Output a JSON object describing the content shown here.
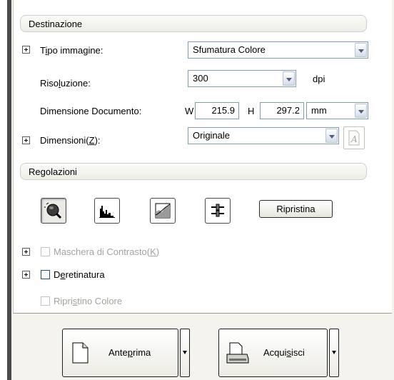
{
  "destinazione": {
    "header": "Destinazione",
    "tipo_label_pre": "T",
    "tipo_label_ul": "i",
    "tipo_label_post": "po immagine:",
    "tipo_value": "Sfumatura Colore",
    "risoluzione_label_pre": "Riso",
    "risoluzione_label_ul": "l",
    "risoluzione_label_post": "uzione:",
    "risoluzione_value": "300",
    "risoluzione_unit": "dpi",
    "dimdoc_label": "Dimensione Documento:",
    "w_label": "W",
    "w_value": "215.9",
    "h_label": "H",
    "h_value": "297.2",
    "unit_value": "mm",
    "dimensioni_label_pre": "Dimensioni(",
    "dimensioni_label_ul": "Z",
    "dimensioni_label_post": "):",
    "dimensioni_value": "Originale"
  },
  "regolazioni": {
    "header": "Regolazioni",
    "ripristina_label": "Ripristina",
    "maschera_pre": "Maschera di Contrasto(",
    "maschera_ul": "K",
    "maschera_post": ")",
    "deretinatura_pre": "D",
    "deretinatura_ul": "e",
    "deretinatura_post": "retinatura",
    "ripristino_pre": "Ripri",
    "ripristino_ul": "s",
    "ripristino_post": "tino Colore"
  },
  "footer": {
    "anteprima_pre": "Ante",
    "anteprima_ul": "p",
    "anteprima_post": "rima",
    "acquisisci_pre": "Acqui",
    "acquisisci_ul": "s",
    "acquisisci_post": "isci"
  },
  "icons": {
    "auto_exposure": "globe-magnifier-icon",
    "histogram": "histogram-icon",
    "tone_curve": "tone-curve-icon",
    "image_adjust": "sliders-icon",
    "resize_size": "text-size-icon",
    "preview": "document-icon",
    "scan": "scanner-icon"
  },
  "colors": {
    "panel_bg": "#ffffff",
    "window_bg": "#f4f3ee",
    "input_border": "#7f9db9"
  }
}
